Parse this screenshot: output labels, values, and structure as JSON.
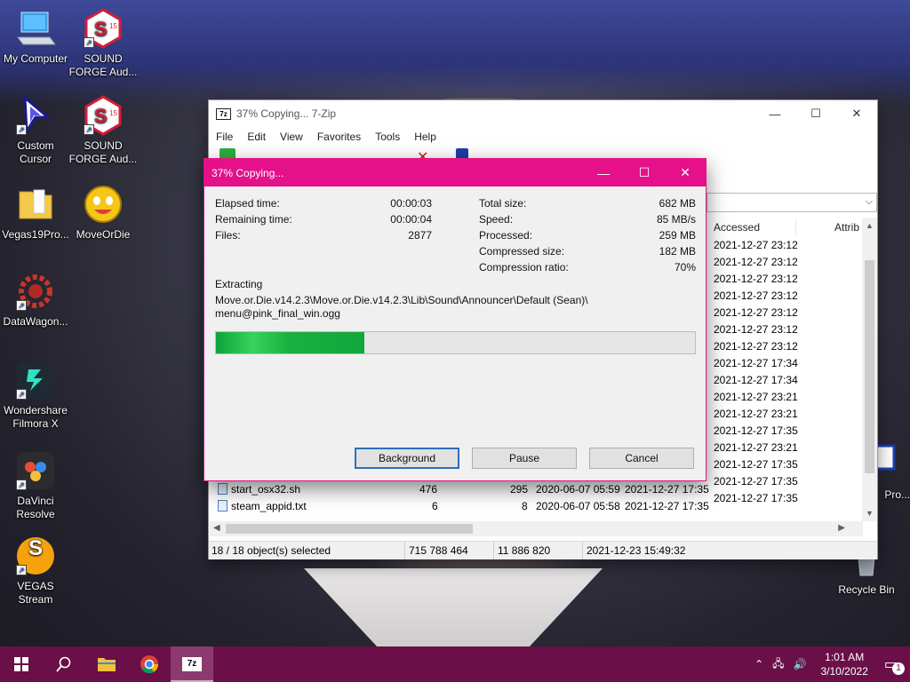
{
  "desktop": {
    "icons": [
      {
        "label": "My Computer"
      },
      {
        "label": "SOUND FORGE Aud..."
      },
      {
        "label": "Custom Cursor"
      },
      {
        "label": "SOUND FORGE Aud..."
      },
      {
        "label": "Vegas19Pro..."
      },
      {
        "label": "MoveOrDie"
      },
      {
        "label": "DataWagon..."
      },
      {
        "label": "Wondershare Filmora X"
      },
      {
        "label": "DaVinci Resolve"
      },
      {
        "label": "VEGAS Stream"
      },
      {
        "label": "Recycle Bin"
      }
    ],
    "sf_badge": "15",
    "vegas_letter": "S",
    "recycle_partial": "Pro..."
  },
  "main_window": {
    "title": "37% Copying... 7-Zip",
    "app_badge": "7z",
    "menu": [
      "File",
      "Edit",
      "View",
      "Favorites",
      "Tools",
      "Help"
    ],
    "columns": {
      "accessed": "Accessed",
      "attrib": "Attrib"
    },
    "accessed_dates": [
      "2021-12-27 23:12",
      "2021-12-27 23:12",
      "2021-12-27 23:12",
      "2021-12-27 23:12",
      "2021-12-27 23:12",
      "2021-12-27 23:12",
      "2021-12-27 23:12",
      "2021-12-27 17:34",
      "2021-12-27 17:34",
      "2021-12-27 23:21",
      "2021-12-27 23:21",
      "2021-12-27 17:35",
      "2021-12-27 23:21",
      "2021-12-27 17:35",
      "2021-12-27 17:35",
      "2021-12-27 17:35"
    ],
    "partial_row": {
      "name": "start_osx32.sh",
      "size": "476",
      "packed": "295",
      "modified": "2020-06-07 05:59",
      "created": "2021-12-27 17:35"
    },
    "last_row": {
      "name": "steam_appid.txt",
      "size": "6",
      "packed": "8",
      "modified": "2020-06-07 05:58",
      "created": "2021-12-27 17:35"
    },
    "status": {
      "selected": "18 / 18 object(s) selected",
      "size": "715 788 464",
      "packed": "11 886 820",
      "date": "2021-12-23 15:49:32"
    }
  },
  "dialog": {
    "title": "37% Copying...",
    "left": [
      {
        "label": "Elapsed time:",
        "value": "00:00:03"
      },
      {
        "label": "Remaining time:",
        "value": "00:00:04"
      },
      {
        "label": "Files:",
        "value": "2877"
      }
    ],
    "right": [
      {
        "label": "Total size:",
        "value": "682 MB"
      },
      {
        "label": "Speed:",
        "value": "85 MB/s"
      },
      {
        "label": "Processed:",
        "value": "259 MB"
      },
      {
        "label": "Compressed size:",
        "value": "182 MB"
      },
      {
        "label": "Compression ratio:",
        "value": "70%"
      }
    ],
    "action": "Extracting",
    "path_line1": "Move.or.Die.v14.2.3\\Move.or.Die.v14.2.3\\Lib\\Sound\\Announcer\\Default (Sean)\\",
    "path_line2": "menu@pink_final_win.ogg",
    "progress_fraction": 0.31,
    "buttons": {
      "background": "Background",
      "pause": "Pause",
      "cancel": "Cancel"
    }
  },
  "taskbar": {
    "time": "1:01 AM",
    "date": "3/10/2022",
    "app_badge": "7z",
    "notification_count": "1"
  }
}
